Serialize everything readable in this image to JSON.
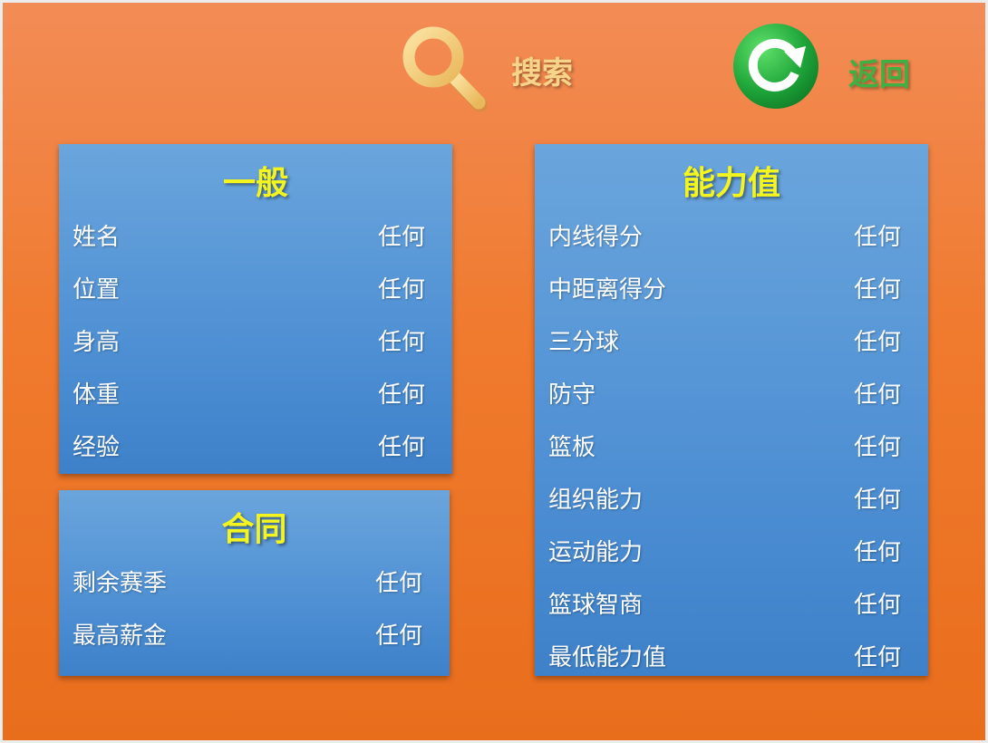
{
  "toolbar": {
    "search_label": "搜索",
    "back_label": "返回"
  },
  "colors": {
    "background": "#f07a2e",
    "panel": "#4f90d4",
    "title": "#f4f51e",
    "search": "#f7d48a",
    "back": "#3fb043"
  },
  "general": {
    "title": "一般",
    "rows": [
      {
        "name": "姓名",
        "value": "任何"
      },
      {
        "name": "位置",
        "value": "任何"
      },
      {
        "name": "身高",
        "value": "任何"
      },
      {
        "name": "体重",
        "value": "任何"
      },
      {
        "name": "经验",
        "value": "任何"
      }
    ]
  },
  "contract": {
    "title": "合同",
    "rows": [
      {
        "name": "剩余赛季",
        "value": "任何"
      },
      {
        "name": "最高薪金",
        "value": "任何"
      }
    ]
  },
  "ability": {
    "title": "能力值",
    "rows": [
      {
        "name": "内线得分",
        "value": "任何"
      },
      {
        "name": "中距离得分",
        "value": "任何"
      },
      {
        "name": "三分球",
        "value": "任何"
      },
      {
        "name": "防守",
        "value": "任何"
      },
      {
        "name": "篮板",
        "value": "任何"
      },
      {
        "name": "组织能力",
        "value": "任何"
      },
      {
        "name": "运动能力",
        "value": "任何"
      },
      {
        "name": "篮球智商",
        "value": "任何"
      },
      {
        "name": "最低能力值",
        "value": "任何"
      }
    ]
  }
}
